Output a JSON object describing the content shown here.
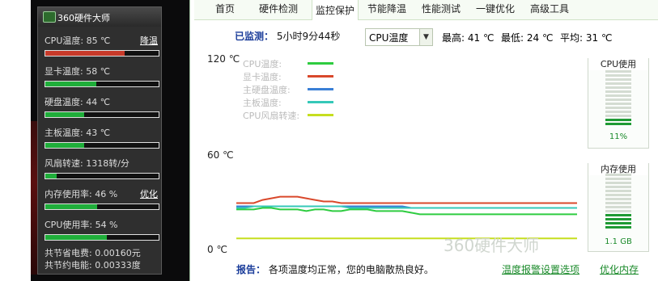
{
  "widget": {
    "title": "360硬件大师",
    "metrics": [
      {
        "label": "CPU温度: 85 ℃",
        "action": "降温",
        "level": 0.7,
        "status": "hot"
      },
      {
        "label": "显卡温度: 58 ℃",
        "action": "",
        "level": 0.45,
        "status": "ok"
      },
      {
        "label": "硬盘温度: 44 ℃",
        "action": "",
        "level": 0.34,
        "status": "ok"
      },
      {
        "label": "主板温度: 43 ℃",
        "action": "",
        "level": 0.34,
        "status": "ok"
      },
      {
        "label": "风扇转速: 1318转/分",
        "action": "",
        "level": 0.1,
        "status": "ok"
      },
      {
        "label": "内存使用率: 46 %",
        "action": "优化",
        "level": 0.46,
        "status": "ok"
      },
      {
        "label": "CPU使用率: 54 %",
        "action": "",
        "level": 0.54,
        "status": "ok"
      }
    ],
    "savings": [
      "共节省电费: 0.00160元",
      "共节约电能: 0.00333度"
    ]
  },
  "tabs": [
    {
      "label": "首页",
      "active": false
    },
    {
      "label": "硬件检测",
      "active": false
    },
    {
      "label": "监控保护",
      "active": true
    },
    {
      "label": "节能降温",
      "active": false
    },
    {
      "label": "性能测试",
      "active": false
    },
    {
      "label": "一键优化",
      "active": false
    },
    {
      "label": "高级工具",
      "active": false
    }
  ],
  "monitor": {
    "elapsed_label": "已监测：",
    "elapsed_value": "5小时9分44秒",
    "select_value": "CPU温度",
    "max": "最高: 41 ℃",
    "min": "最低: 24 ℃",
    "avg": "平均: 31 ℃"
  },
  "chart_data": {
    "type": "line",
    "yticks": [
      "120 ℃",
      "60 ℃",
      "0 ℃"
    ],
    "ylim": [
      0,
      120
    ],
    "grid": false,
    "series": [
      {
        "name": "CPU温度:",
        "color": "#2ecc40",
        "values": [
          27,
          27,
          27,
          28,
          28,
          27,
          27,
          27,
          26,
          27,
          27,
          26,
          26,
          27,
          27,
          27,
          26,
          26,
          26,
          26,
          25,
          24,
          24,
          24,
          24,
          24,
          24,
          24,
          24,
          24,
          24,
          24,
          24,
          24,
          24,
          24,
          24,
          24,
          24,
          24
        ]
      },
      {
        "name": "显卡温度:",
        "color": "#d9482b",
        "values": [
          31,
          31,
          31,
          33,
          34,
          35,
          35,
          35,
          34,
          33,
          32,
          32,
          31,
          31,
          31,
          31,
          31,
          31,
          31,
          31,
          31,
          31,
          31,
          31,
          31,
          31,
          31,
          31,
          31,
          31,
          31,
          31,
          31,
          31,
          31,
          31,
          31,
          31,
          31,
          31
        ]
      },
      {
        "name": "主硬盘温度:",
        "color": "#3a7fd6",
        "values": [
          29,
          29,
          29,
          29,
          29,
          29,
          29,
          29,
          29,
          29,
          29,
          29,
          29,
          29,
          29,
          29,
          29,
          29,
          29,
          29,
          28,
          28,
          28,
          28,
          28,
          28,
          28,
          28,
          28,
          28,
          28,
          28,
          28,
          28,
          28,
          28,
          28,
          28,
          28,
          28
        ]
      },
      {
        "name": "主板温度:",
        "color": "#35c8b8",
        "values": [
          28,
          28,
          29,
          29,
          29,
          29,
          29,
          29,
          29,
          29,
          29,
          29,
          29,
          28,
          28,
          28,
          28,
          28,
          28,
          28,
          28,
          28,
          28,
          28,
          28,
          28,
          28,
          28,
          28,
          28,
          28,
          28,
          28,
          28,
          28,
          28,
          28,
          28,
          28,
          28
        ]
      },
      {
        "name": "CPU风扇转速:",
        "color": "#c6de1f",
        "values": [
          9,
          9,
          9,
          9,
          9,
          9,
          9,
          9,
          9,
          9,
          9,
          9,
          9,
          9,
          9,
          9,
          9,
          9,
          9,
          9,
          9,
          9,
          9,
          9,
          9,
          9,
          9,
          9,
          9,
          9,
          9,
          9,
          9,
          9,
          9,
          9,
          9,
          9,
          9,
          9
        ]
      }
    ]
  },
  "gauges": [
    {
      "title": "CPU使用",
      "value": "11%",
      "level": 0.11
    },
    {
      "title": "内存使用",
      "value": "1.1 GB",
      "level": 0.25
    }
  ],
  "report": {
    "label": "报告：",
    "text": "各项温度均正常，您的电脑散热良好。",
    "link1": "温度报警设置选项",
    "link2": "优化内存"
  },
  "watermark": "360硬件大师"
}
